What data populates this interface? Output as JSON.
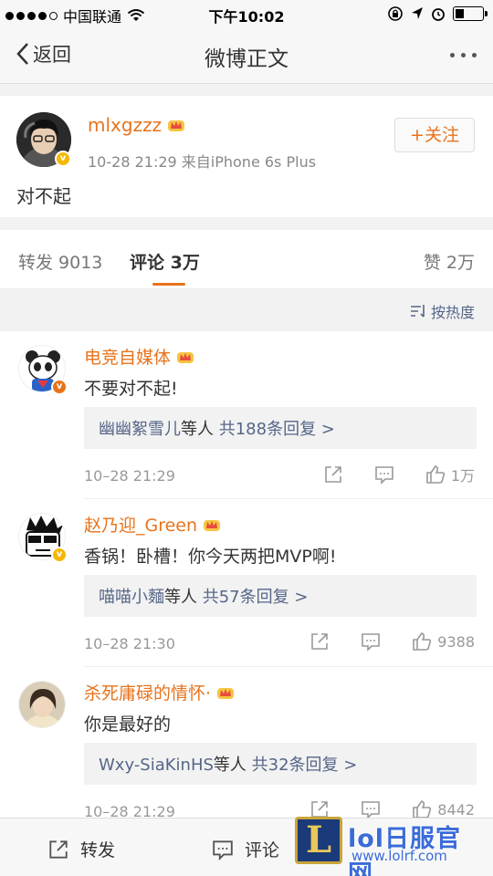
{
  "status_bar": {
    "carrier": "中国联通",
    "time": "下午10:02"
  },
  "nav": {
    "back_label": "返回",
    "title": "微博正文"
  },
  "post": {
    "username": "mlxgzzz",
    "time": "10-28 21:29",
    "source": "来自iPhone 6s Plus",
    "content": "对不起",
    "follow_label": "+关注"
  },
  "tabs": {
    "repost": "转发 9013",
    "comments_label": "评论",
    "comments_count": "3万",
    "likes": "赞 2万"
  },
  "sort": {
    "label": "按热度"
  },
  "comments": [
    {
      "username": "电竞自媒体",
      "text": "不要对不起!",
      "reply_users": "幽幽絮雪儿",
      "reply_suffix": "等人",
      "reply_count": "共188条回复 >",
      "time": "10–28 21:29",
      "likes": "1万"
    },
    {
      "username": "赵乃迎_Green",
      "text": "香锅！卧槽！你今天两把MVP啊!",
      "reply_users": "喵喵小麵",
      "reply_suffix": "等人",
      "reply_count": "共57条回复 >",
      "time": "10–28 21:30",
      "likes": "9388"
    },
    {
      "username": "杀死庸碌的情怀·",
      "text": "你是最好的",
      "reply_users": "Wxy-SiaKinHS",
      "reply_suffix": "等人",
      "reply_count": "共32条回复 >",
      "time": "10–28 21:29",
      "likes": "8442"
    }
  ],
  "toolbar": {
    "repost": "转发",
    "comment": "评论"
  },
  "watermark": {
    "name": "lol日服官网",
    "url": "www.lolrf.com"
  },
  "colors": {
    "accent": "#e8731c",
    "link": "#556688"
  }
}
